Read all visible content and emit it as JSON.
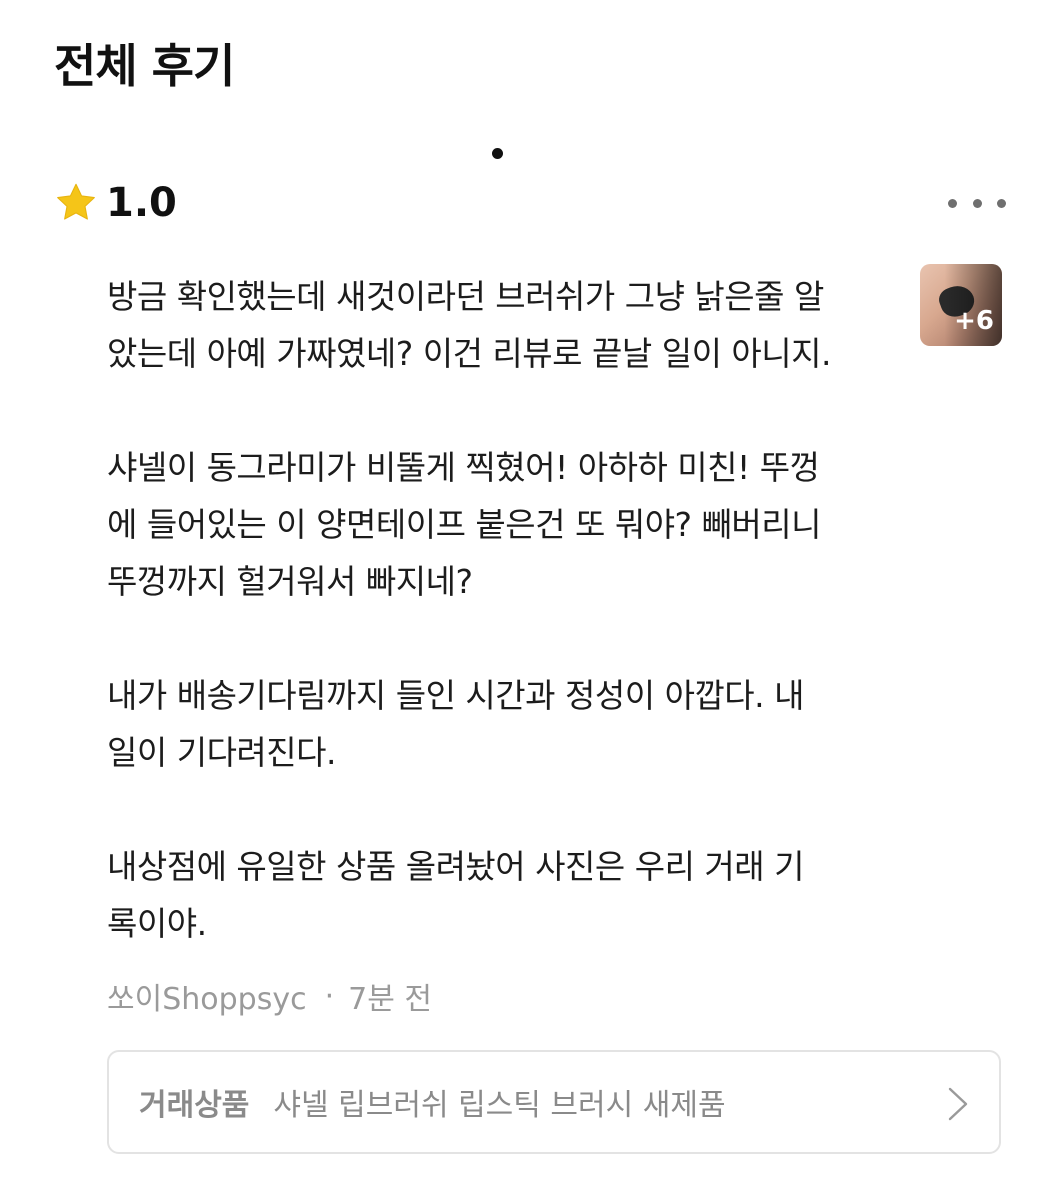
{
  "header": {
    "title": "전체 후기"
  },
  "review": {
    "rating": "1.0",
    "paragraphs": [
      "방금 확인했는데 새것이라던 브러쉬가 그냥 낡은줄 알\n았는데 아예 가짜였네? 이건 리뷰로 끝날 일이 아니지.",
      "샤넬이 동그라미가 비뚤게 찍혔어! 아하하 미친! 뚜껑\n에 들어있는 이 양면테이프 붙은건 또 뭐야? 빼버리니\n뚜껑까지 헐거워서 빠지네?",
      "내가 배송기다림까지 들인 시간과 정성이 아깝다. 내\n일이 기다려진다.",
      "내상점에 유일한 상품 올려놨어 사진은 우리 거래 기\n록이야."
    ],
    "photo_extra_count": "+6",
    "author": "쏘이Shoppsyc",
    "separator": "·",
    "time": "7분 전"
  },
  "product": {
    "label": "거래상품",
    "name": "샤넬 립브러쉬 립스틱 브러시 새제품"
  },
  "icons": {
    "star": "star-icon",
    "more": "more-icon",
    "chevron": "chevron-right-icon"
  },
  "colors": {
    "star": "#F5C518",
    "text": "#1c1c1c",
    "muted": "#9a9a9a",
    "border": "#e3e3e3"
  }
}
